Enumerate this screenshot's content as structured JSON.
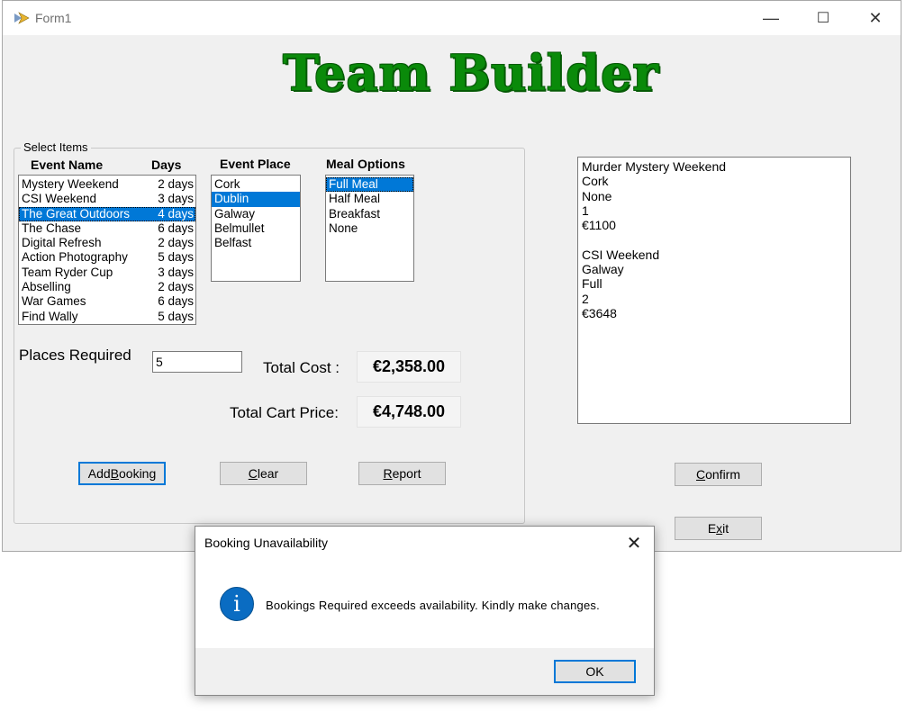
{
  "window": {
    "title": "Form1",
    "minimize": "—",
    "maximize": "☐",
    "close": "✕"
  },
  "heading": "Team Builder",
  "group_caption": "Select Items",
  "columns": {
    "event_name": "Event Name",
    "days": "Days",
    "event_place": "Event Place",
    "meal_options": "Meal Options"
  },
  "events": [
    {
      "name": "Mystery Weekend",
      "days": "2 days"
    },
    {
      "name": "CSI Weekend",
      "days": "3 days"
    },
    {
      "name": "The Great Outdoors",
      "days": "4 days"
    },
    {
      "name": "The Chase",
      "days": "6 days"
    },
    {
      "name": "Digital Refresh",
      "days": "2 days"
    },
    {
      "name": "Action Photography",
      "days": "5 days"
    },
    {
      "name": "Team Ryder Cup",
      "days": "3 days"
    },
    {
      "name": "Abselling",
      "days": "2 days"
    },
    {
      "name": "War Games",
      "days": "6 days"
    },
    {
      "name": "Find Wally",
      "days": "5 days"
    }
  ],
  "places": [
    "Cork",
    "Dublin",
    "Galway",
    "Belmullet",
    "Belfast"
  ],
  "meals": [
    "Full Meal",
    "Half Meal",
    "Breakfast",
    "None"
  ],
  "places_required": {
    "label": "Places Required",
    "value": "5"
  },
  "total_cost": {
    "label": "Total Cost :",
    "value": "€2,358.00"
  },
  "total_cart": {
    "label": "Total Cart Price:",
    "value": "€4,748.00"
  },
  "buttons": {
    "add_booking": {
      "pre": "Add ",
      "key": "B",
      "post": "ooking"
    },
    "clear": {
      "pre": "",
      "key": "C",
      "post": "lear"
    },
    "report": {
      "pre": "",
      "key": "R",
      "post": "eport"
    },
    "confirm": {
      "pre": "",
      "key": "C",
      "post": "onfirm"
    },
    "exit": {
      "pre": "E",
      "key": "x",
      "post": "it"
    }
  },
  "cart_lines": [
    "Murder Mystery Weekend",
    "Cork",
    "None",
    "1",
    "€1100",
    "",
    "CSI Weekend",
    "Galway",
    "Full",
    "2",
    "€3648"
  ],
  "dialog": {
    "title": "Booking Unavailability",
    "close": "✕",
    "icon": "i",
    "message": "Bookings Required exceeds availability. Kindly make changes.",
    "ok": "OK"
  },
  "colors": {
    "heading": "#0a8a0a",
    "selection": "#0078d7",
    "info_icon": "#0a6cc2"
  }
}
